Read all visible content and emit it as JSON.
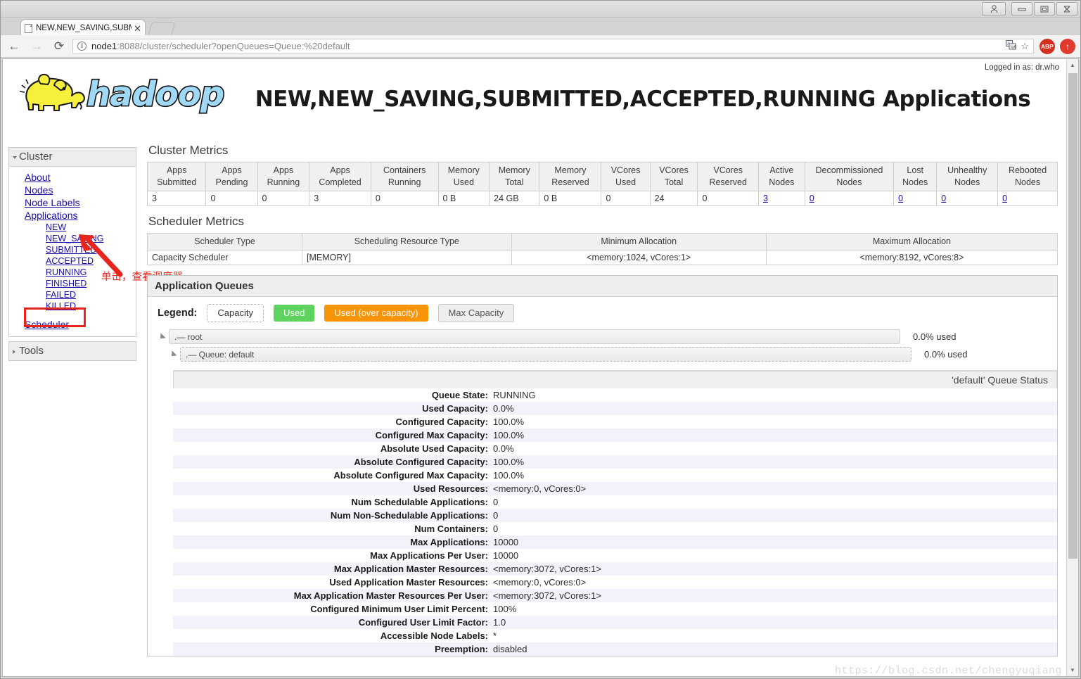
{
  "browser": {
    "tab_title": "NEW,NEW_SAVING,SUBMI",
    "url_host": "node1",
    "url_path": ":8088/cluster/scheduler?openQueues=Queue:%20default",
    "back_icon": "←",
    "forward_icon": "→",
    "reload_icon": "⟳",
    "info_icon": "i",
    "translate_icon": "文",
    "star_icon": "☆",
    "abp_label": "ABP",
    "up_icon": "↑",
    "tab_close_icon": "✕",
    "person_icon": "☰",
    "minimize_icon": "–",
    "maximize_icon": "□",
    "close_icon": "✕"
  },
  "header": {
    "logged_in": "Logged in as: dr.who",
    "title": "NEW,NEW_SAVING,SUBMITTED,ACCEPTED,RUNNING Applications",
    "logo_text": "hadoop"
  },
  "sidebar": {
    "cluster": {
      "label": "Cluster",
      "items": [
        {
          "label": "About"
        },
        {
          "label": "Nodes"
        },
        {
          "label": "Node Labels"
        },
        {
          "label": "Applications"
        }
      ],
      "app_states": [
        {
          "label": "NEW"
        },
        {
          "label": "NEW_SAVING"
        },
        {
          "label": "SUBMITTED"
        },
        {
          "label": "ACCEPTED"
        },
        {
          "label": "RUNNING"
        },
        {
          "label": "FINISHED"
        },
        {
          "label": "FAILED"
        },
        {
          "label": "KILLED"
        }
      ],
      "scheduler": "Scheduler"
    },
    "tools": {
      "label": "Tools"
    }
  },
  "annotation": {
    "text": "单击，查看调度器",
    "color": "#e8241c"
  },
  "cluster_metrics": {
    "section_title": "Cluster Metrics",
    "columns": [
      "Apps Submitted",
      "Apps Pending",
      "Apps Running",
      "Apps Completed",
      "Containers Running",
      "Memory Used",
      "Memory Total",
      "Memory Reserved",
      "VCores Used",
      "VCores Total",
      "VCores Reserved",
      "Active Nodes",
      "Decommissioned Nodes",
      "Lost Nodes",
      "Unhealthy Nodes",
      "Rebooted Nodes"
    ],
    "values": [
      "3",
      "0",
      "0",
      "3",
      "0",
      "0 B",
      "24 GB",
      "0 B",
      "0",
      "24",
      "0",
      "3",
      "0",
      "0",
      "0",
      "0"
    ],
    "link_columns": [
      11,
      12,
      13,
      14,
      15
    ]
  },
  "scheduler_metrics": {
    "section_title": "Scheduler Metrics",
    "columns": [
      "Scheduler Type",
      "Scheduling Resource Type",
      "Minimum Allocation",
      "Maximum Allocation"
    ],
    "row": [
      "Capacity Scheduler",
      "[MEMORY]",
      "<memory:1024, vCores:1>",
      "<memory:8192, vCores:8>"
    ]
  },
  "application_queues": {
    "title": "Application Queues",
    "legend_label": "Legend:",
    "legend": [
      {
        "label": "Capacity",
        "kind": "capacity",
        "color": "#ffffff"
      },
      {
        "label": "Used",
        "kind": "used",
        "color": "#5fd35f"
      },
      {
        "label": "Used (over capacity)",
        "kind": "over",
        "color": "#f89406"
      },
      {
        "label": "Max Capacity",
        "kind": "max",
        "color": "#eeeeee"
      }
    ],
    "queues": [
      {
        "label": ".— root",
        "used": "0.0% used",
        "depth": 0
      },
      {
        "label": ".— Queue: default",
        "used": "0.0% used",
        "depth": 1
      }
    ]
  },
  "queue_status": {
    "title": "'default' Queue Status",
    "rows": [
      {
        "key": "Queue State:",
        "value": "RUNNING"
      },
      {
        "key": "Used Capacity:",
        "value": "0.0%"
      },
      {
        "key": "Configured Capacity:",
        "value": "100.0%"
      },
      {
        "key": "Configured Max Capacity:",
        "value": "100.0%"
      },
      {
        "key": "Absolute Used Capacity:",
        "value": "0.0%"
      },
      {
        "key": "Absolute Configured Capacity:",
        "value": "100.0%"
      },
      {
        "key": "Absolute Configured Max Capacity:",
        "value": "100.0%"
      },
      {
        "key": "Used Resources:",
        "value": "<memory:0, vCores:0>"
      },
      {
        "key": "Num Schedulable Applications:",
        "value": "0"
      },
      {
        "key": "Num Non-Schedulable Applications:",
        "value": "0"
      },
      {
        "key": "Num Containers:",
        "value": "0"
      },
      {
        "key": "Max Applications:",
        "value": "10000"
      },
      {
        "key": "Max Applications Per User:",
        "value": "10000"
      },
      {
        "key": "Max Application Master Resources:",
        "value": "<memory:3072, vCores:1>"
      },
      {
        "key": "Used Application Master Resources:",
        "value": "<memory:0, vCores:0>"
      },
      {
        "key": "Max Application Master Resources Per User:",
        "value": "<memory:3072, vCores:1>"
      },
      {
        "key": "Configured Minimum User Limit Percent:",
        "value": "100%"
      },
      {
        "key": "Configured User Limit Factor:",
        "value": "1.0"
      },
      {
        "key": "Accessible Node Labels:",
        "value": "*"
      },
      {
        "key": "Preemption:",
        "value": "disabled"
      }
    ]
  },
  "watermark": "https://blog.csdn.net/chengyuqiang"
}
